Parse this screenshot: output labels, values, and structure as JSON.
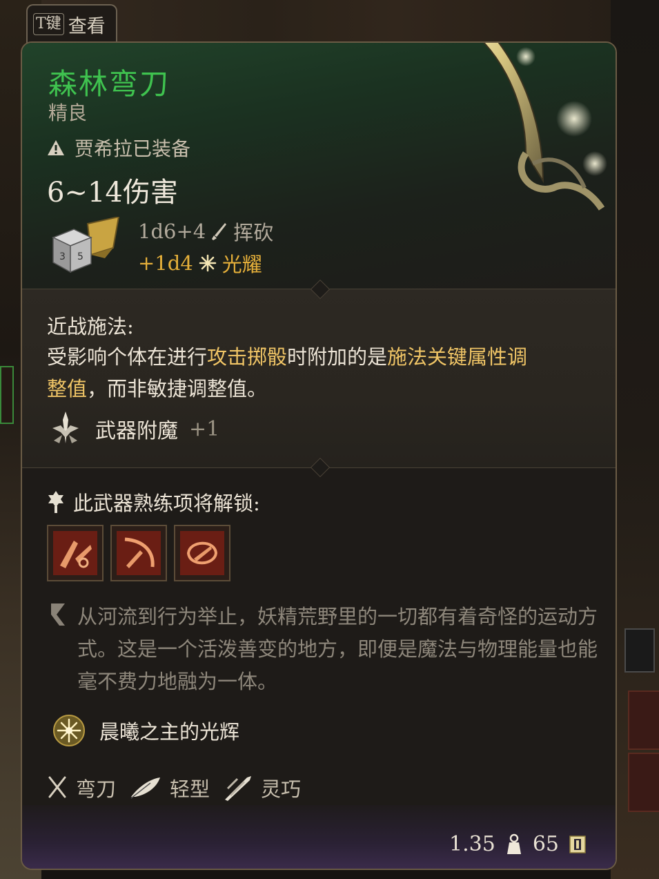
{
  "tab": {
    "key": "T键",
    "label": "查看"
  },
  "item": {
    "name": "森林弯刀",
    "rarity": "精良",
    "equipped_by": "贾希拉已装备",
    "damage_total": "6~14伤害",
    "damage_lines": [
      {
        "dice": "1d6+4",
        "type": "挥砍",
        "icon": "slash-icon"
      },
      {
        "dice": "+1d4",
        "type": "光耀",
        "icon": "radiant-icon"
      }
    ]
  },
  "melee_casting": {
    "title": "近战施法:",
    "desc_part1": "受影响个体在进行",
    "desc_hl1": "攻击掷骰",
    "desc_part2": "时附加的是",
    "desc_hl2": "施法关键属性调整值",
    "desc_part3": "，而非敏捷调整值。"
  },
  "enchant": {
    "label": "武器附魔",
    "bonus": "+1"
  },
  "proficiency": {
    "label": "此武器熟练项将解锁:",
    "actions": [
      "action-1",
      "action-2",
      "action-3"
    ]
  },
  "lore": "从河流到行为举止，妖精荒野里的一切都有着奇怪的运动方式。这是一个活泼善变的地方，即便是魔法与物理能量也能毫不费力地融为一体。",
  "passive": {
    "label": "晨曦之主的光辉"
  },
  "properties": [
    {
      "label": "弯刀",
      "icon": "crossed-swords-icon"
    },
    {
      "label": "轻型",
      "icon": "feather-icon"
    },
    {
      "label": "灵巧",
      "icon": "finesse-icon"
    }
  ],
  "footer": {
    "weight": "1.35",
    "value": "65"
  },
  "colors": {
    "name": "#3fc24f",
    "highlight": "#f0c566",
    "radiant": "#e6b03a"
  }
}
